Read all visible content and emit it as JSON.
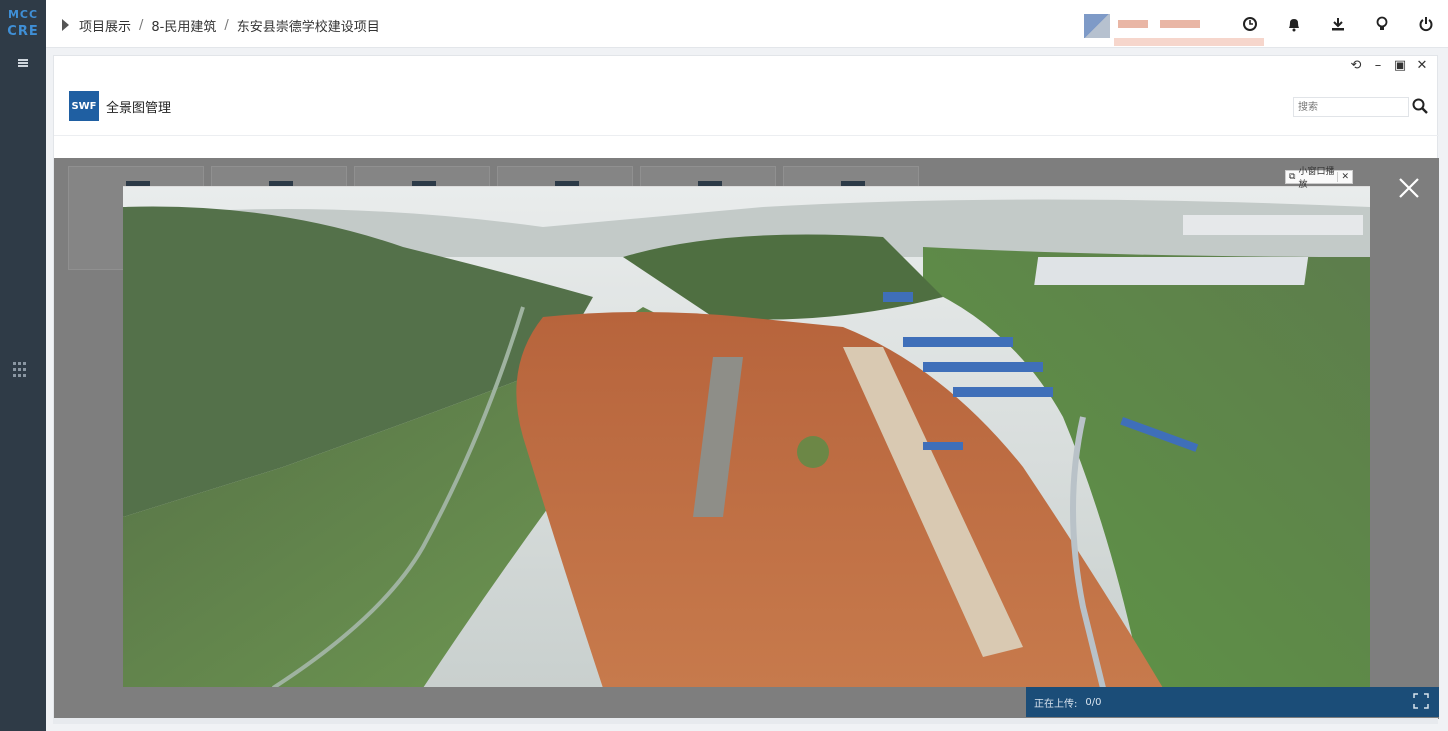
{
  "logo": {
    "line1": "MCC",
    "line2": "CRE"
  },
  "breadcrumb": {
    "items": [
      "项目展示",
      "8-民用建筑",
      "东安县崇德学校建设项目"
    ],
    "separator": "/"
  },
  "toolbar_icons": [
    "clock-icon",
    "bell-icon",
    "download-icon",
    "bulb-icon",
    "power-icon"
  ],
  "app": {
    "badge": "SWF",
    "title": "全景图管理",
    "search_placeholder": "搜索"
  },
  "viewer": {
    "small_window_label": "小窗口播放",
    "small_window_close": "✕"
  },
  "upload": {
    "label": "正在上传:",
    "value": "0/0"
  },
  "colors": {
    "rail": "#2f3b47",
    "brand_blue": "#1f5fa2",
    "upload_bar": "#1b4d78",
    "overlay": "#7e7e7e"
  }
}
